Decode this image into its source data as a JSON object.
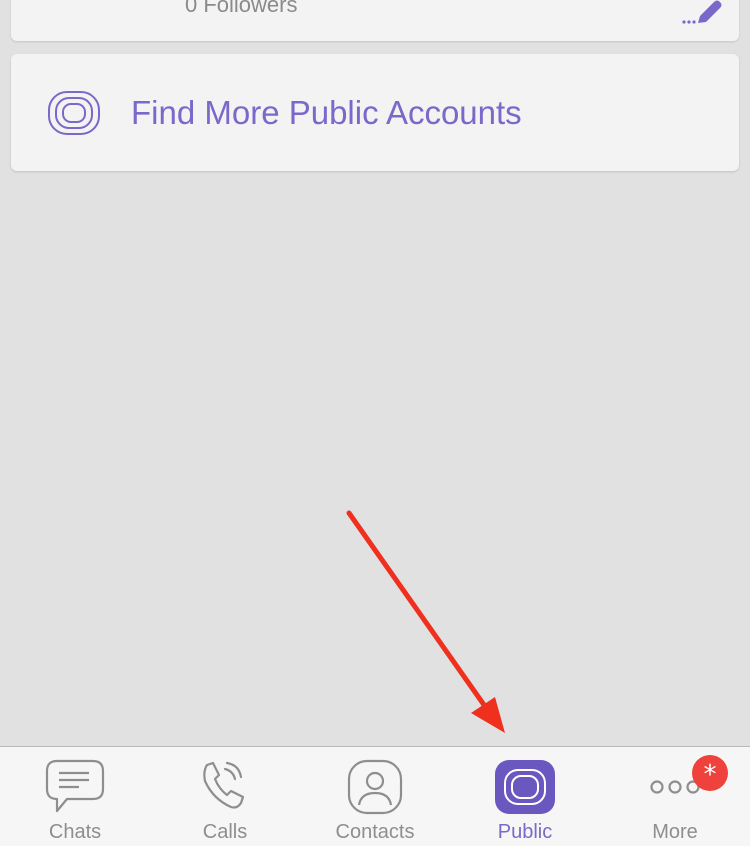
{
  "account_card": {
    "followers_text": "0 Followers",
    "edit_icon": "pencil-edit-icon"
  },
  "find_more": {
    "label": "Find More Public Accounts",
    "icon": "public-accounts-icon"
  },
  "tabbar": {
    "tabs": [
      {
        "label": "Chats",
        "icon": "chat-bubble-icon",
        "active": false
      },
      {
        "label": "Calls",
        "icon": "phone-icon",
        "active": false
      },
      {
        "label": "Contacts",
        "icon": "contact-person-icon",
        "active": false
      },
      {
        "label": "Public",
        "icon": "public-accounts-icon",
        "active": true
      },
      {
        "label": "More",
        "icon": "more-dots-icon",
        "active": false,
        "badge": "*"
      }
    ]
  },
  "annotation": {
    "arrow_color": "#f0301f",
    "points_to": "Public"
  },
  "colors": {
    "accent": "#7b68c8",
    "background": "#e1e1e1",
    "badge": "#f0423c"
  }
}
